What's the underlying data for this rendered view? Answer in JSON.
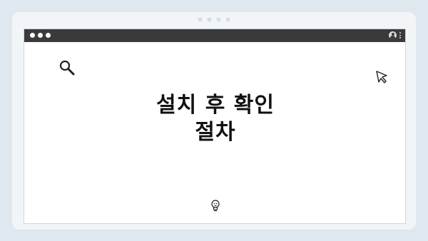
{
  "pager": {
    "dots": 4
  },
  "window": {
    "title_bar_icons": [
      "profile-icon",
      "kebab-menu-icon"
    ],
    "traffic_lights": [
      "window-dot",
      "window-dot",
      "window-dot"
    ]
  },
  "main": {
    "headline_line1": "설치 후 확인",
    "headline_line2": "절차"
  },
  "icons": {
    "top_left": "search-icon",
    "top_right": "cursor-icon",
    "bottom_center": "lightbulb-icon"
  },
  "colors": {
    "background": "#dfe7ef",
    "card": "#f2f5f8",
    "titlebar": "#3a3a3c",
    "text": "#111111"
  }
}
